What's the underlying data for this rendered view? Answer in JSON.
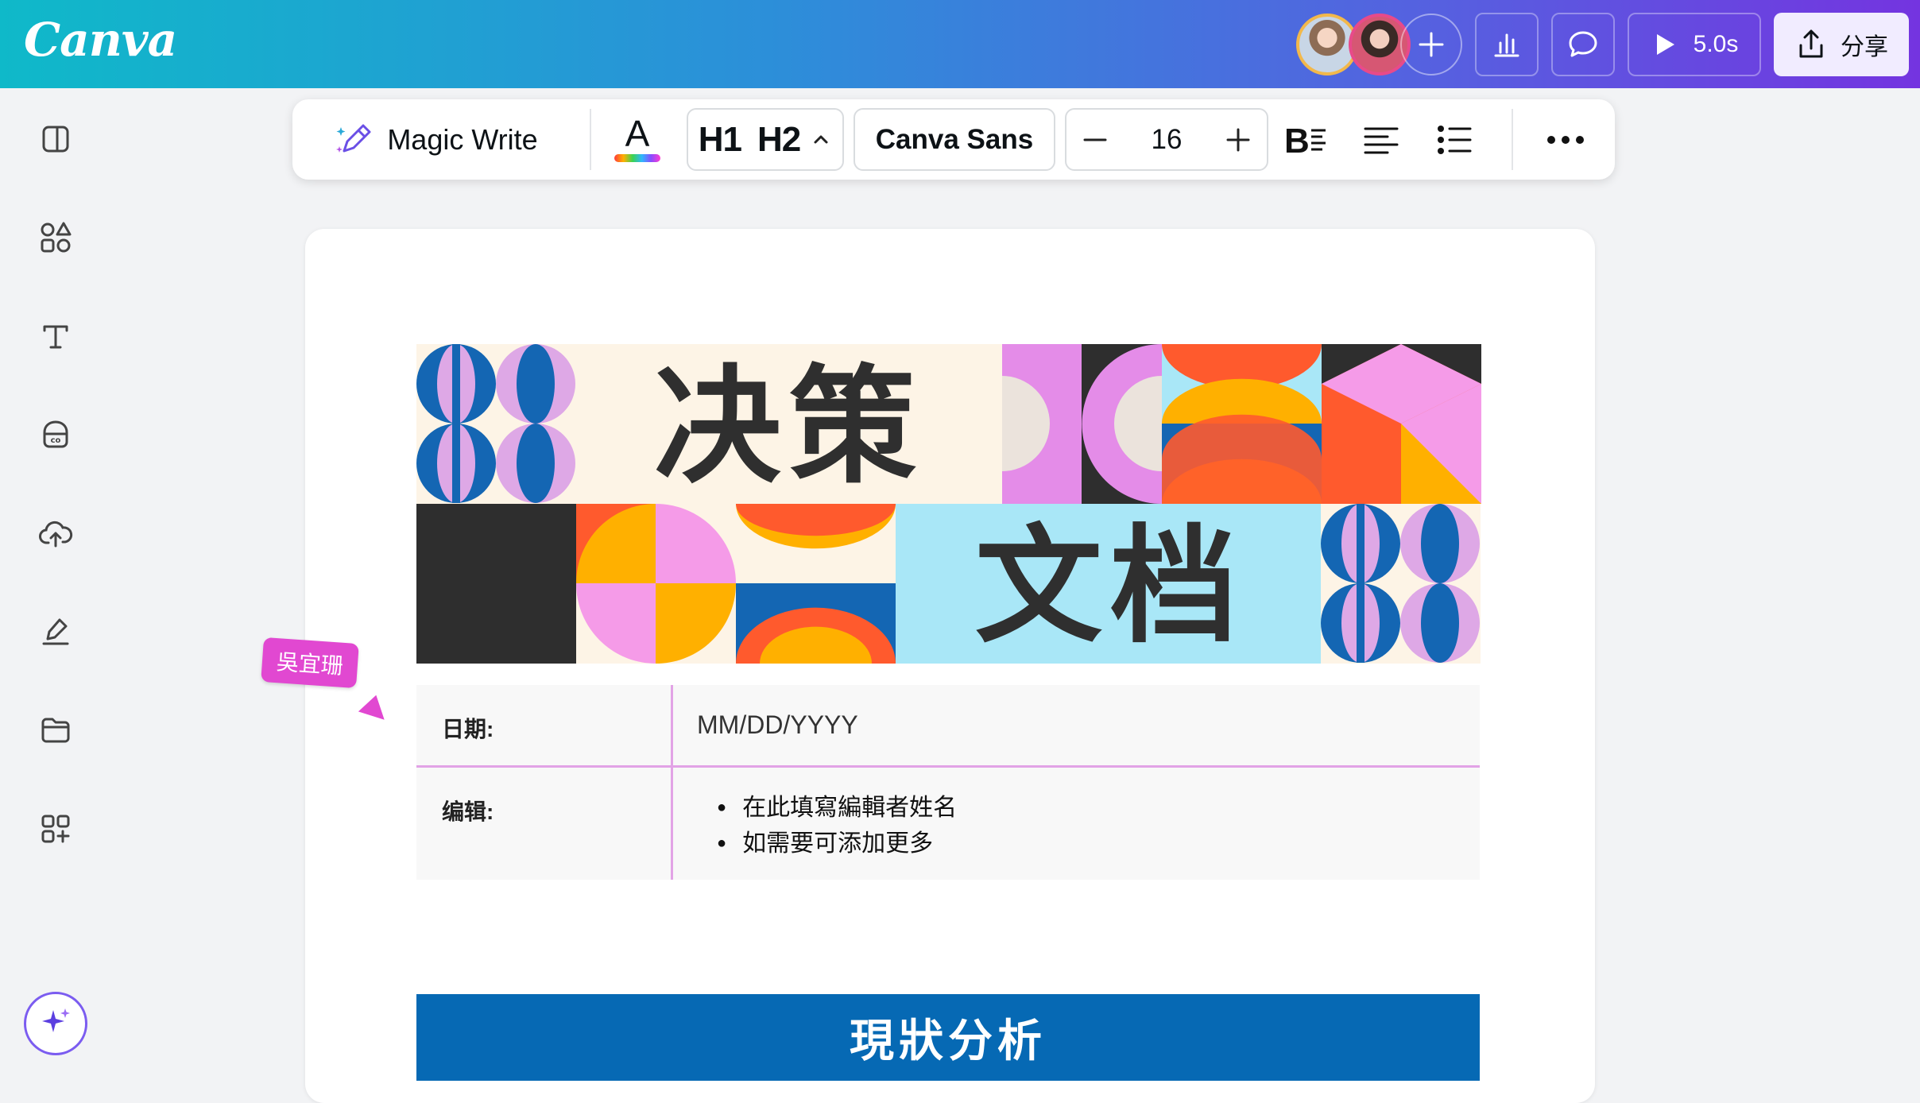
{
  "header": {
    "logo": "Canva",
    "play_time": "5.0s",
    "share_label": "分享"
  },
  "sidebar": {
    "items": [
      "layout-icon",
      "elements-icon",
      "text-icon",
      "brand-icon",
      "upload-icon",
      "draw-icon",
      "projects-icon",
      "apps-icon"
    ]
  },
  "toolbar": {
    "magic_write": "Magic Write",
    "text_color_letter": "A",
    "h1": "H1",
    "h2": "H2",
    "font": "Canva Sans",
    "font_size": "16"
  },
  "document": {
    "title_line1": [
      "决",
      "策"
    ],
    "title_line2": [
      "文",
      "档"
    ],
    "table": {
      "rows": [
        {
          "label": "日期:",
          "value": "MM/DD/YYYY"
        },
        {
          "label": "编辑:",
          "items": [
            "在此填寫編輯者姓名",
            "如需要可添加更多"
          ]
        }
      ]
    },
    "section_heading": "現狀分析"
  },
  "collaborator_cursor": {
    "name": "吳宜珊",
    "color": "#e148d1"
  },
  "colors": {
    "accent": "#0669b4",
    "magenta": "#e148d1"
  }
}
